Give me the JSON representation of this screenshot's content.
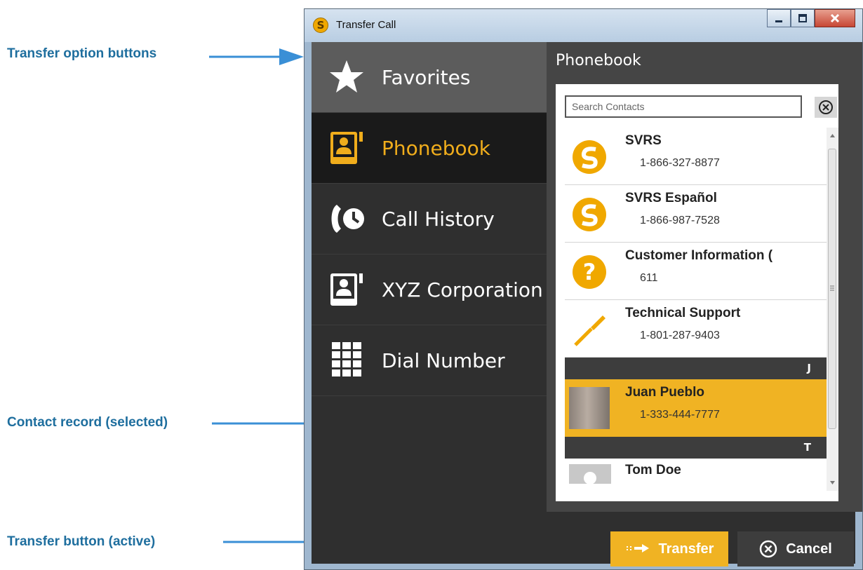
{
  "annotations": {
    "transfer_options": "Transfer option buttons",
    "contact_record": "Contact record (selected)",
    "transfer_button": "Transfer button (active)"
  },
  "window": {
    "title": "Transfer Call",
    "app_icon": "svrs-logo-icon",
    "controls": [
      "minimize-icon",
      "maximize-icon",
      "close-icon"
    ]
  },
  "nav": {
    "items": [
      {
        "label": "Favorites",
        "icon": "star-icon"
      },
      {
        "label": "Phonebook",
        "icon": "phonebook-icon"
      },
      {
        "label": "Call History",
        "icon": "call-history-icon"
      },
      {
        "label": "XYZ Corporation",
        "icon": "corporate-phonebook-icon"
      },
      {
        "label": "Dial Number",
        "icon": "dialpad-icon"
      }
    ],
    "active": "Phonebook"
  },
  "phonebook": {
    "title": "Phonebook",
    "search_placeholder": "Search Contacts",
    "contacts": [
      {
        "name": "SVRS",
        "phone": "1-866-327-8877",
        "icon": "svrs-logo-icon"
      },
      {
        "name": "SVRS Español",
        "phone": "1-866-987-7528",
        "icon": "svrs-logo-icon"
      },
      {
        "name": "Customer Information (",
        "phone": "611",
        "icon": "question-icon"
      },
      {
        "name": "Technical Support",
        "phone": "1-801-287-9403",
        "icon": "screwdriver-icon"
      }
    ],
    "section_j": "J",
    "selected_contact": {
      "name": "Juan Pueblo",
      "phone": "1-333-444-7777"
    },
    "section_t": "T",
    "last_contact": {
      "name": "Tom Doe"
    }
  },
  "buttons": {
    "transfer": "Transfer",
    "cancel": "Cancel"
  },
  "colors": {
    "accent": "#f0b323",
    "annotation": "#1e6e9e",
    "arrow": "#3a8fd6",
    "panel_dark": "#2f2f2f"
  }
}
